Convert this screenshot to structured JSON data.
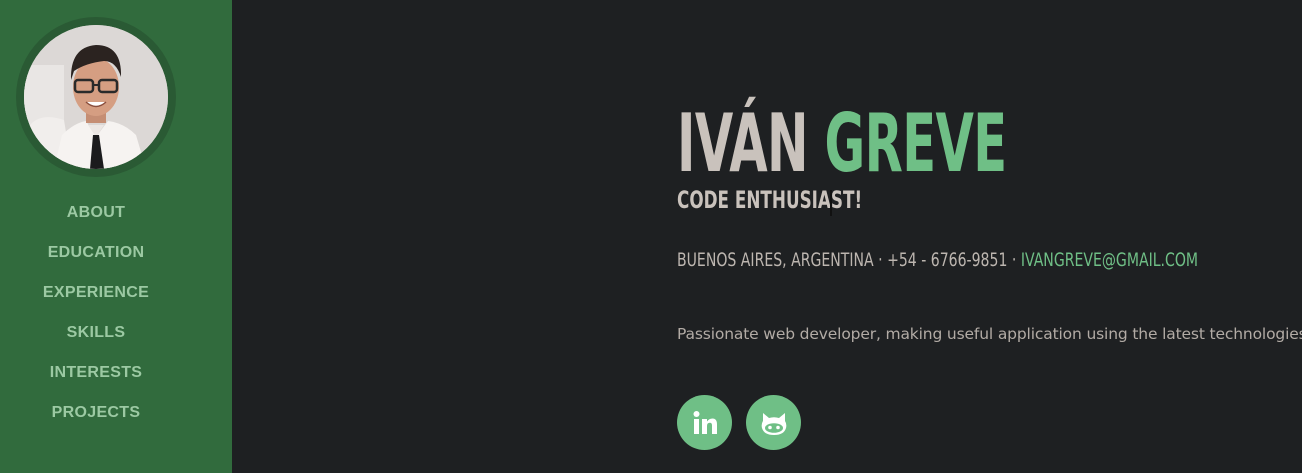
{
  "profile": {
    "first_name": "IVÁN",
    "last_name": "GREVE",
    "tagline": "CODE ENTHUSIAST!",
    "location": "BUENOS AIRES, ARGENTINA",
    "phone": "+54 - 6766-9851",
    "email": "IVANGREVE@GMAIL.COM",
    "separator": "·",
    "bio": "Passionate web developer, making useful application using the latest technologies!"
  },
  "nav": {
    "items": [
      {
        "label": "ABOUT"
      },
      {
        "label": "EDUCATION"
      },
      {
        "label": "EXPERIENCE"
      },
      {
        "label": "SKILLS"
      },
      {
        "label": "INTERESTS"
      },
      {
        "label": "PROJECTS"
      }
    ]
  },
  "social": [
    {
      "icon": "linkedin-icon"
    },
    {
      "icon": "github-icon"
    }
  ],
  "colors": {
    "sidebar": "#316b3d",
    "accent": "#6fbf86",
    "background": "#1e2022",
    "name_text": "#c9c2bc"
  }
}
